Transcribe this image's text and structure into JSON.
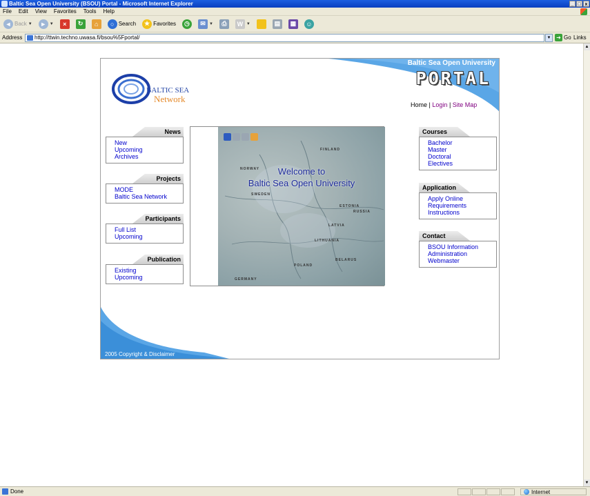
{
  "window": {
    "title": "Baltic Sea Open University (BSOU) Portal - Microsoft Internet Explorer",
    "controls": [
      "_",
      "□",
      "x"
    ]
  },
  "menu": [
    "File",
    "Edit",
    "View",
    "Favorites",
    "Tools",
    "Help"
  ],
  "toolbar": {
    "back": "Back",
    "search": "Search",
    "favorites": "Favorites"
  },
  "address": {
    "label": "Address",
    "url": "http://ttwin.techno.uwasa.fi/bsou%5Fportal/",
    "go": "Go",
    "links": "Links"
  },
  "status": {
    "text": "Done",
    "zone": "Internet"
  },
  "page": {
    "university": "Baltic Sea Open University",
    "portal": "PORTAL",
    "logo": {
      "line1": "BALTIC SEA",
      "line2": "Network"
    },
    "nav": {
      "home": "Home",
      "sep1": "|",
      "login": "Login",
      "sep2": "|",
      "sitemap": "Site Map"
    },
    "left_boxes": [
      {
        "title": "News",
        "links": [
          "New",
          "Upcoming",
          "Archives"
        ]
      },
      {
        "title": "Projects",
        "links": [
          "MODE",
          "Baltic Sea Network"
        ]
      },
      {
        "title": "Participants",
        "links": [
          "Full List",
          "Upcoming"
        ]
      },
      {
        "title": "Publication",
        "links": [
          "Existing",
          "Upcoming"
        ]
      }
    ],
    "right_boxes": [
      {
        "title": "Courses",
        "links": [
          "Bachelor",
          "Master",
          "Doctoral",
          "Electives"
        ]
      },
      {
        "title": "Application",
        "links": [
          "Apply Online",
          "Requirements",
          "Instructions"
        ]
      },
      {
        "title": "Contact",
        "links": [
          "BSOU Information",
          "Administration",
          "Webmaster"
        ]
      }
    ],
    "welcome": {
      "line1": "Welcome to",
      "line2": "Baltic Sea Open University"
    },
    "map_labels": [
      "FINLAND",
      "NORWAY",
      "SWEDEN",
      "RUSSIA",
      "LATVIA",
      "LITHUANIA",
      "BELARUS",
      "POLAND",
      "GERMANY",
      "ESTONIA"
    ],
    "copyright": "2005 Copyright & Disclaimer"
  },
  "colors": {
    "swoosh": "#5aa6e6",
    "link": "#0000cc",
    "visited": "#800080",
    "welcome": "#1c2a9a"
  }
}
